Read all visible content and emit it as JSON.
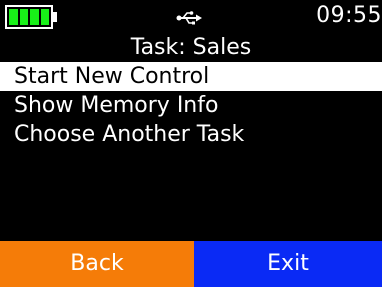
{
  "status_bar": {
    "battery_icon": "battery-full-icon",
    "battery_color": "#18f018",
    "battery_level": 1.0,
    "usb_icon": "usb-icon",
    "time": "09:55"
  },
  "title": "Task: Sales",
  "menu": {
    "items": [
      {
        "label": "Start New Control",
        "selected": true
      },
      {
        "label": "Show Memory Info",
        "selected": false
      },
      {
        "label": "Choose Another Task",
        "selected": false
      }
    ]
  },
  "softkeys": {
    "back_label": "Back",
    "back_color": "#f57c08",
    "exit_label": "Exit",
    "exit_color": "#0a2af5"
  }
}
